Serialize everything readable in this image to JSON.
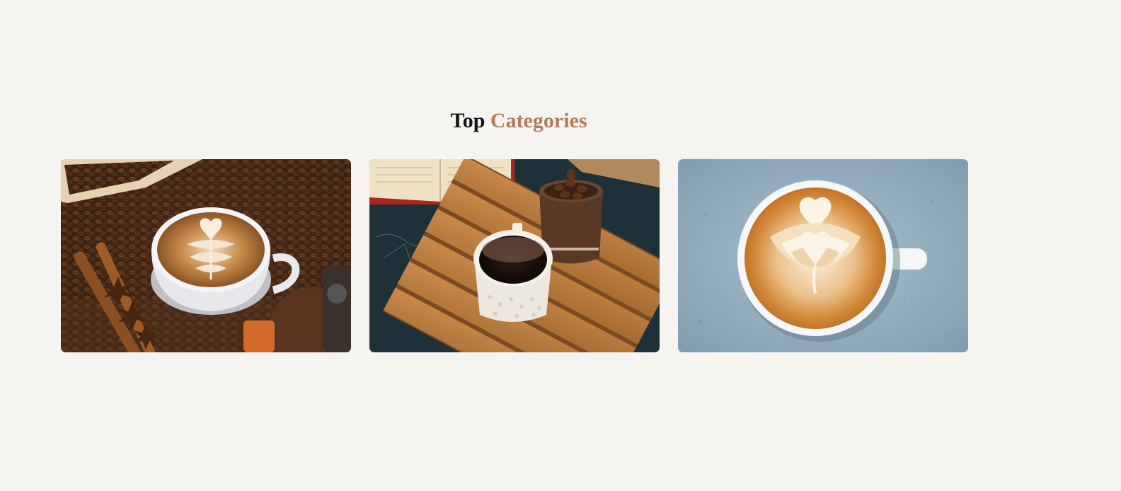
{
  "section": {
    "title_part1": "Top",
    "title_part2": "Categories",
    "accent_color": "#b07c5a",
    "title_color": "#141414"
  },
  "categories": [
    {
      "image": "latte-with-coffee-beans-and-cinnamon"
    },
    {
      "image": "black-coffee-on-wooden-crate"
    },
    {
      "image": "latte-art-on-blue-background"
    }
  ]
}
